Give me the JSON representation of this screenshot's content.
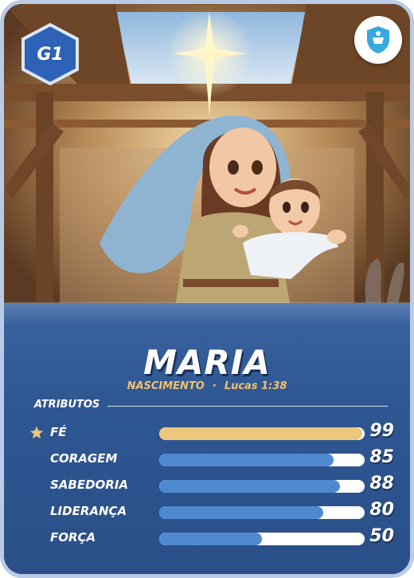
{
  "card": {
    "generation_badge": "G1",
    "logo_icon": "shield-icon",
    "name": "MARIA",
    "subtitle": {
      "event": "NASCIMENTO",
      "separator": "·",
      "reference": "Lucas 1:38"
    },
    "section_title": "ATRIBUTOS"
  },
  "colors": {
    "accent_gold": "#ecc87d",
    "bar_blue": "#4f8ad0",
    "card_blue": "#2d4f86"
  },
  "attributes": [
    {
      "label": "FÉ",
      "value": "99",
      "level": 0.99,
      "highlight": true,
      "icon": "star-icon"
    },
    {
      "label": "CORAGEM",
      "value": "85",
      "level": 0.85,
      "highlight": false
    },
    {
      "label": "SABEDORIA",
      "value": "88",
      "level": 0.88,
      "highlight": false
    },
    {
      "label": "LIDERANÇA",
      "value": "80",
      "level": 0.8,
      "highlight": false
    },
    {
      "label": "FORÇA",
      "value": "50",
      "level": 0.5,
      "highlight": false
    }
  ]
}
